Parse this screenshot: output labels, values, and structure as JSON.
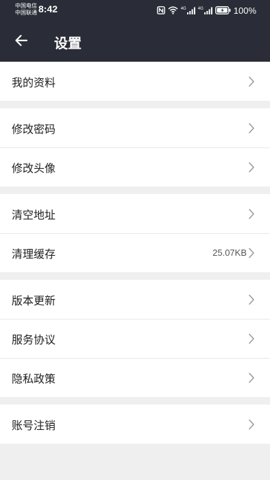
{
  "status_bar": {
    "carrier_1": "中国电信",
    "carrier_2": "中国联通",
    "time": "8:42",
    "network_1": "4G",
    "network_2": "4G",
    "battery": "100%",
    "icons": [
      "nfc-icon",
      "wifi-icon",
      "signal-icon",
      "signal-icon",
      "battery-charging-icon"
    ]
  },
  "header": {
    "title": "设置",
    "back_icon": "arrow-left-icon"
  },
  "settings": {
    "my_profile": "我的资料",
    "change_password": "修改密码",
    "change_avatar": "修改头像",
    "clear_address": "清空地址",
    "clear_cache": "清理缓存",
    "cache_size": "25.07KB",
    "version_update": "版本更新",
    "service_agreement": "服务协议",
    "privacy_policy": "隐私政策",
    "delete_account": "账号注销"
  },
  "colors": {
    "header_bg": "#2a2d37",
    "page_bg": "#efefef",
    "row_bg": "#ffffff",
    "text": "#222222",
    "chevron": "#9a9a9a"
  }
}
